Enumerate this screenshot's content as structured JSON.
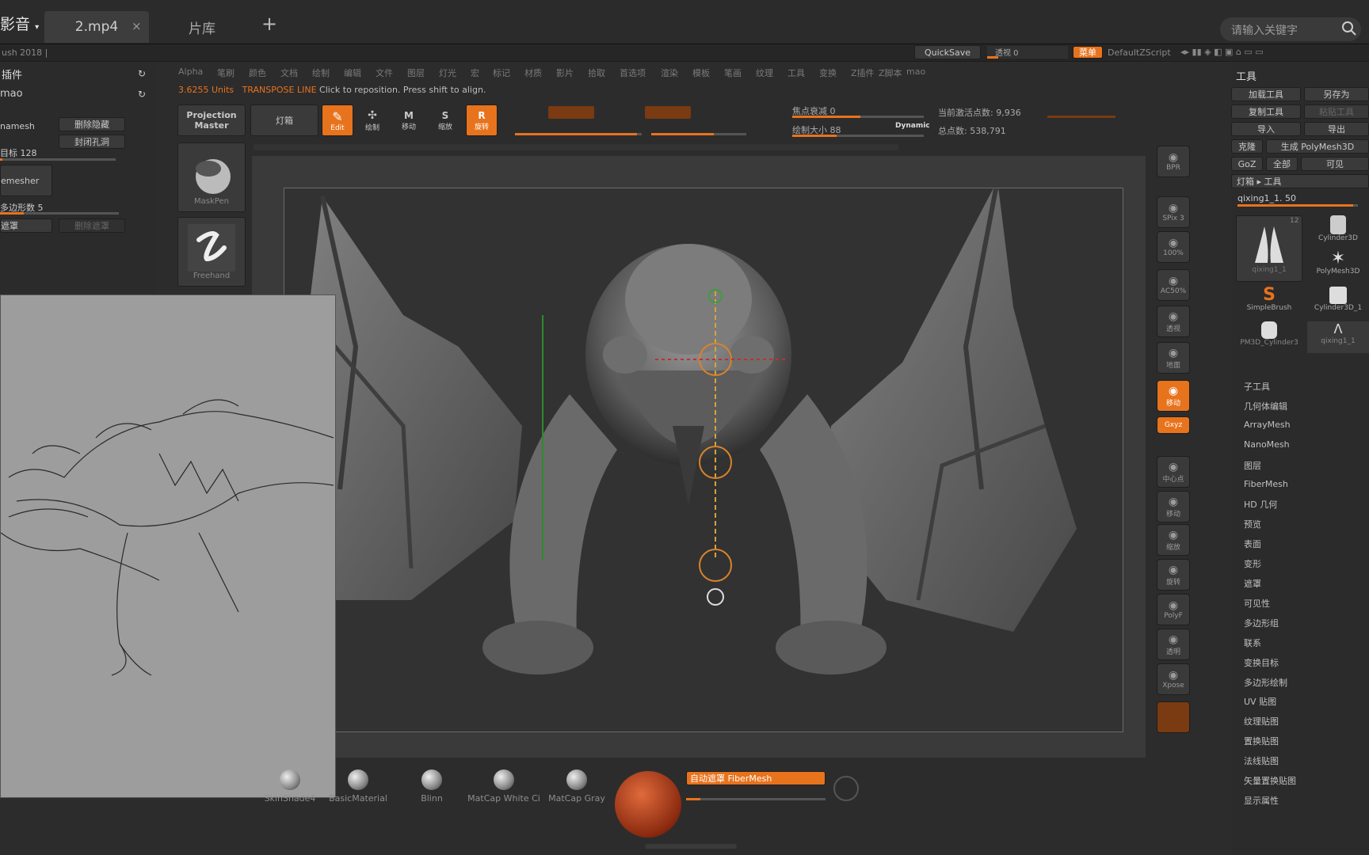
{
  "player": {
    "app_title": "影音",
    "tabs": [
      {
        "label": "2.mp4",
        "active": true
      },
      {
        "label": "片库",
        "active": false
      }
    ],
    "close": "×",
    "add": "+",
    "search_placeholder": "请输入关键字"
  },
  "zbrush": {
    "title": "ush 2018 |",
    "quicksave": "QuickSave",
    "progress_label": "透视 0",
    "menu_button": "菜单",
    "script": "DefaultZScript",
    "menus": [
      "Alpha",
      "笔刷",
      "颜色",
      "文档",
      "绘制",
      "编辑",
      "文件",
      "图层",
      "灯光",
      "宏",
      "标记",
      "材质",
      "影片",
      "拾取",
      "首选项",
      "渲染",
      "模板",
      "笔画",
      "纹理",
      "工具",
      "变换",
      "Z插件",
      "Z脚本",
      "mao"
    ],
    "units": "3.6255 Units",
    "transpose": "TRANSPOSE LINE",
    "hint": "Click to reposition. Press shift to align.",
    "projection_master": [
      "Projection",
      "Master"
    ],
    "lightbox": "灯箱",
    "modes": [
      {
        "icon": "Edit",
        "label": "Edit"
      },
      {
        "icon": "绘制",
        "label": "绘制"
      },
      {
        "icon": "M",
        "label": "移动"
      },
      {
        "icon": "S",
        "label": "缩放"
      },
      {
        "icon": "R",
        "label": "旋转"
      }
    ],
    "focal": "焦点衰减 0",
    "draw_size": "绘制大小 88",
    "dynamic": "Dynamic",
    "active_points": "当前激活点数: 9,936",
    "total_points": "总点数: 538,791",
    "left_panel": {
      "title": "插件",
      "sub": "mao",
      "zremesher_rows": [
        [
          "namesh",
          "删除隐藏"
        ],
        [
          "",
          "封闭孔洞"
        ]
      ],
      "target": "目标 128",
      "zremesher": "emesher",
      "poly": "多边形数 5",
      "brush_row": [
        "遮罩",
        "删除遮罩"
      ]
    },
    "brushes": [
      "MaskPen",
      "Freehand"
    ],
    "materials": [
      "SkinShade4",
      "BasicMaterial",
      "Blinn",
      "MatCap White Ci",
      "MatCap Gray"
    ],
    "fibermesh_bar": "自动遮罩 FiberMesh",
    "right_shelf": [
      "BPR",
      "SPix 3",
      "100%",
      "AC50%",
      "透视",
      "地面",
      "移动",
      "Gxyz",
      "中心点",
      "移动",
      "缩放",
      "旋转",
      "PolyF",
      "透明",
      "Xpose"
    ],
    "tool_panel": {
      "title": "工具",
      "buttons": [
        [
          "加载工具",
          "另存为"
        ],
        [
          "复制工具",
          "粘贴工具"
        ],
        [
          "导入",
          "导出"
        ],
        [
          "克隆",
          "生成 PolyMesh3D"
        ],
        [
          "GoZ",
          "全部",
          "可见"
        ],
        [
          "灯箱 ▸ 工具"
        ]
      ],
      "current": "qixing1_1. 50",
      "thumbs": [
        "qixing1_1",
        "Cylinder3D",
        "PolyMesh3D",
        "SimpleBrush",
        "Cylinder3D_1",
        "PM3D_Cylinder3",
        "qixing1_1"
      ],
      "thumb_count": "12",
      "items": [
        "子工具",
        "几何体编辑",
        "ArrayMesh",
        "NanoMesh",
        "图层",
        "FiberMesh",
        "HD 几何",
        "预览",
        "表面",
        "变形",
        "遮罩",
        "可见性",
        "多边形组",
        "联系",
        "变换目标",
        "多边形绘制",
        "UV 贴图",
        "纹理贴图",
        "置换贴图",
        "法线贴图",
        "矢量置换贴图",
        "显示属性"
      ]
    }
  },
  "colors": {
    "accent": "#e8731d",
    "bg": "#2c2c2c"
  }
}
